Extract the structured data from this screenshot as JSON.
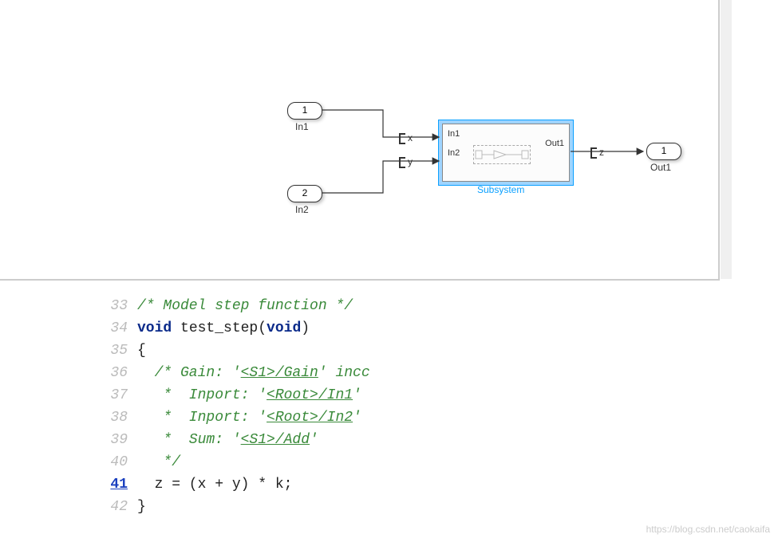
{
  "diagram": {
    "in1": {
      "num": "1",
      "label": "In1"
    },
    "in2": {
      "num": "2",
      "label": "In2"
    },
    "out1": {
      "num": "1",
      "label": "Out1"
    },
    "tag_x": "x",
    "tag_y": "y",
    "tag_z": "z",
    "sub_in1": "In1",
    "sub_in2": "In2",
    "sub_out1": "Out1",
    "sub_label": "Subsystem"
  },
  "code": {
    "lines": [
      {
        "n": "33",
        "seg": [
          {
            "cls": "c-comment",
            "t": "/* Model step function */"
          }
        ]
      },
      {
        "n": "34",
        "seg": [
          {
            "cls": "c-kw",
            "t": "void"
          },
          {
            "cls": "c-plain",
            "t": " test_step("
          },
          {
            "cls": "c-kw",
            "t": "void"
          },
          {
            "cls": "c-plain",
            "t": ")"
          }
        ]
      },
      {
        "n": "35",
        "seg": [
          {
            "cls": "c-plain",
            "t": "{"
          }
        ]
      },
      {
        "n": "36",
        "seg": [
          {
            "cls": "c-comment",
            "t": "  /* Gain: '"
          },
          {
            "cls": "c-link",
            "t": "<S1>/Gain"
          },
          {
            "cls": "c-comment",
            "t": "' incc"
          }
        ]
      },
      {
        "n": "37",
        "seg": [
          {
            "cls": "c-comment",
            "t": "   *  Inport: '"
          },
          {
            "cls": "c-link",
            "t": "<Root>/In1"
          },
          {
            "cls": "c-comment",
            "t": "'"
          }
        ]
      },
      {
        "n": "38",
        "seg": [
          {
            "cls": "c-comment",
            "t": "   *  Inport: '"
          },
          {
            "cls": "c-link",
            "t": "<Root>/In2"
          },
          {
            "cls": "c-comment",
            "t": "'"
          }
        ]
      },
      {
        "n": "39",
        "seg": [
          {
            "cls": "c-comment",
            "t": "   *  Sum: '"
          },
          {
            "cls": "c-link",
            "t": "<S1>/Add"
          },
          {
            "cls": "c-comment",
            "t": "'"
          }
        ]
      },
      {
        "n": "40",
        "seg": [
          {
            "cls": "c-comment",
            "t": "   */"
          }
        ]
      },
      {
        "n": "41",
        "hl": true,
        "seg": [
          {
            "cls": "c-plain",
            "t": "  z = (x + y) * k;"
          }
        ]
      },
      {
        "n": "42",
        "seg": [
          {
            "cls": "c-plain",
            "t": "}"
          }
        ]
      }
    ]
  },
  "watermark": "https://blog.csdn.net/caokaifa"
}
